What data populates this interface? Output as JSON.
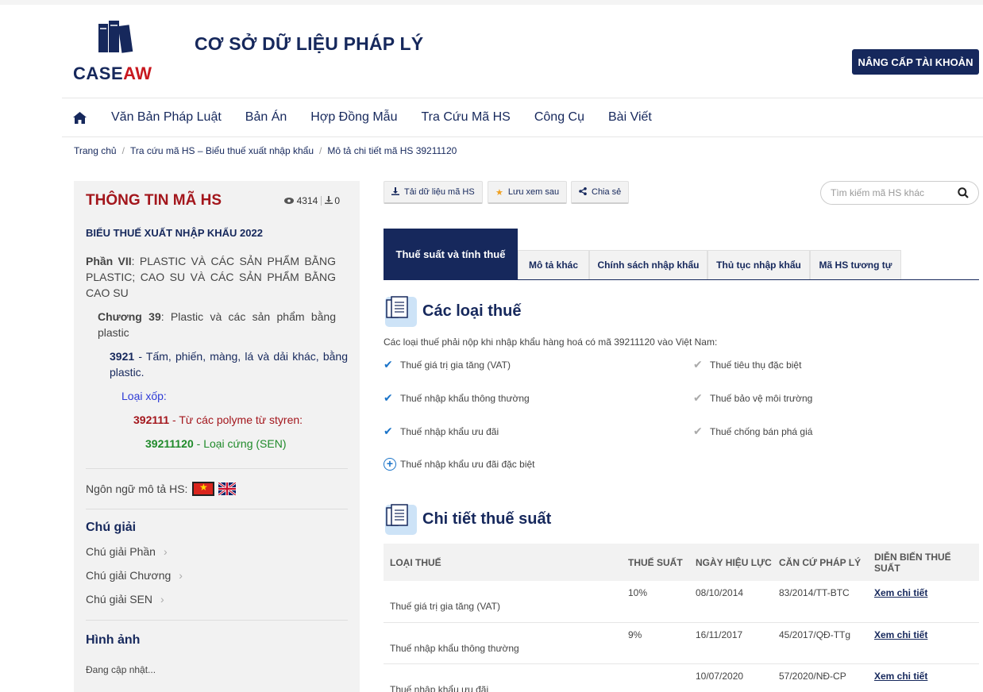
{
  "header": {
    "logo_part1": "CASE",
    "logo_part2": "AW",
    "site_title": "CƠ SỞ DỮ LIỆU PHÁP LÝ",
    "upgrade_label": "NÂNG CẤP TÀI KHOẢN",
    "brand_color": "#16285c",
    "accent_color": "#c8181f"
  },
  "nav": {
    "home_icon": "home-icon",
    "items": [
      "Văn Bản Pháp Luật",
      "Bản Án",
      "Hợp Đồng Mẫu",
      "Tra Cứu Mã HS",
      "Công Cụ",
      "Bài Viết"
    ]
  },
  "breadcrumb": [
    "Trang chủ",
    "Tra cứu mã HS – Biểu thuế xuất nhập khẩu",
    "Mô tả chi tiết mã HS 39211120"
  ],
  "sidebar": {
    "title": "THÔNG TIN MÃ HS",
    "views": "4314",
    "downloads": "0",
    "year_title": "BIỂU THUẾ XUẤT NHẬP KHẨU 2022",
    "part_label": "Phần VII",
    "part_text": ": PLASTIC VÀ CÁC SẢN PHẨM BẰNG PLASTIC; CAO SU VÀ CÁC SẢN PHẨM BẰNG CAO SU",
    "chapter_label": "Chương 39",
    "chapter_text": ": Plastic và các sản phẩm bằng plastic",
    "heading_code": "3921",
    "heading_text": " - Tấm, phiến, màng, lá và dải khác, bằng plastic.",
    "xop": "Loại xốp:",
    "sub_code": "392111",
    "sub_text": " - Từ các polyme từ styren:",
    "sen_code": "39211120",
    "sen_text": " - Loại cứng (SEN)",
    "lang_label": "Ngôn ngữ mô tả HS:",
    "notes_title": "Chú giải",
    "notes": [
      "Chú giải Phần",
      "Chú giải Chương",
      "Chú giải SEN"
    ],
    "images_title": "Hình ảnh",
    "updating": "Đang cập nhật..."
  },
  "actions": {
    "download": "Tải dữ liệu mã HS",
    "save": "Lưu xem sau",
    "share": "Chia sẻ",
    "search_placeholder": "Tìm kiếm mã HS khác"
  },
  "tabs": [
    "Thuế suất và tính thuế",
    "Mô tả khác",
    "Chính sách nhập khẩu",
    "Thủ tục nhập khẩu",
    "Mã HS tương tự"
  ],
  "taxes": {
    "title": "Các loại thuế",
    "description": "Các loại thuế phải nộp khi nhập khẩu hàng hoá có mã 39211120 vào Việt Nam:",
    "left": [
      "Thuế giá trị gia tăng (VAT)",
      "Thuế nhập khẩu thông thường",
      "Thuế nhập khẩu ưu đãi"
    ],
    "right": [
      "Thuế tiêu thụ đặc biệt",
      "Thuế bảo vệ môi trường",
      "Thuế chống bán phá giá"
    ],
    "extra": "Thuế nhập khẩu ưu đãi đặc biệt"
  },
  "rates": {
    "title": "Chi tiết thuế suất",
    "headers": [
      "LOẠI THUẾ",
      "THUẾ SUẤT",
      "NGÀY HIỆU LỰC",
      "CĂN CỨ PHÁP LÝ",
      "DIỄN BIẾN THUẾ SUẤT"
    ],
    "rows": [
      {
        "name": "Thuế giá trị gia tăng (VAT)",
        "rate": "10%",
        "date": "08/10/2014",
        "basis": "83/2014/TT-BTC",
        "link": "Xem chi tiết"
      },
      {
        "name": "Thuế nhập khẩu thông thường",
        "rate": "9%",
        "date": "16/11/2017",
        "basis": "45/2017/QĐ-TTg",
        "link": "Xem chi tiết"
      },
      {
        "name": "Thuế nhập khẩu ưu đãi",
        "rate": "",
        "date": "10/07/2020",
        "basis": "57/2020/NĐ-CP",
        "link": "Xem chi tiết"
      }
    ]
  }
}
